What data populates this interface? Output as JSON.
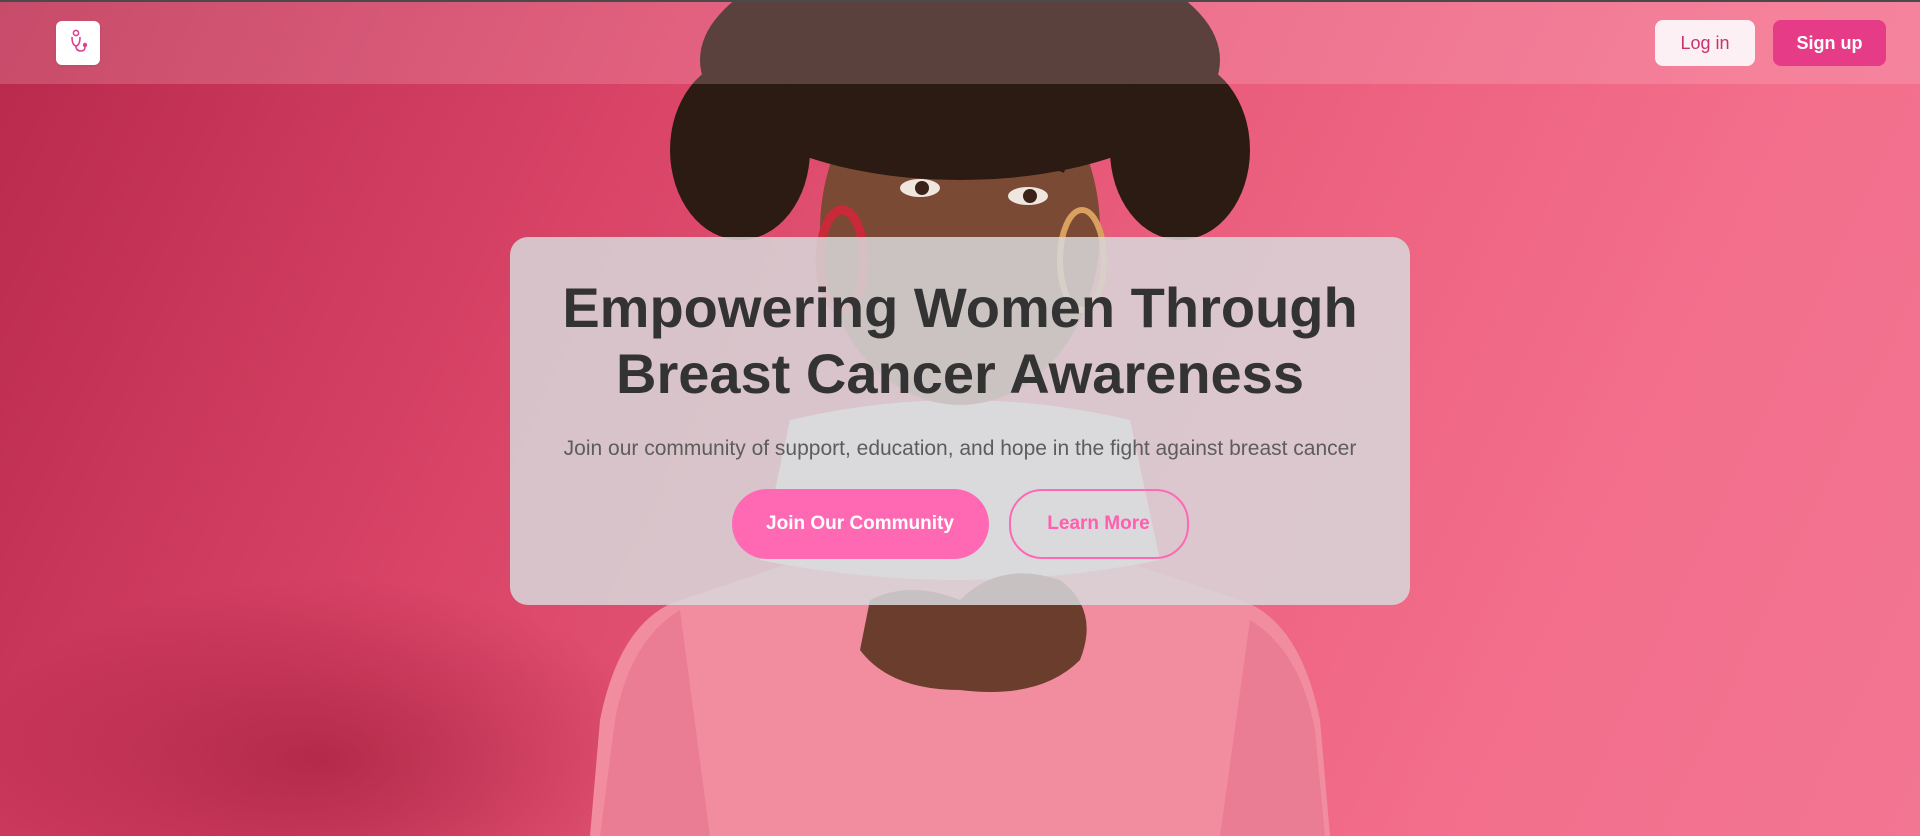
{
  "header": {
    "logo_icon": "stethoscope-icon",
    "login_label": "Log in",
    "signup_label": "Sign up"
  },
  "hero": {
    "title_line1": "Empowering Women Through",
    "title_line2": "Breast Cancer Awareness",
    "subtitle": "Join our community of support, education, and hope in the fight against breast cancer",
    "primary_cta": "Join Our Community",
    "secondary_cta": "Learn More"
  },
  "colors": {
    "brand_pink": "#ff69b4",
    "signup_bg": "#e63b86",
    "background": "#e34f70",
    "title_text": "#333333"
  }
}
